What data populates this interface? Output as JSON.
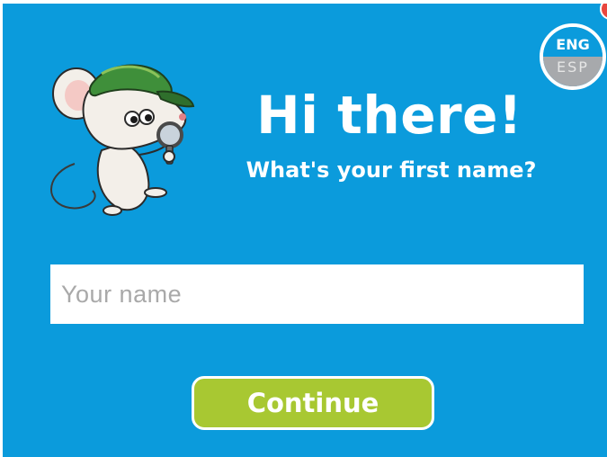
{
  "greeting": {
    "title": "Hi there!",
    "subtitle": "What's your first name?"
  },
  "name_input": {
    "value": "",
    "placeholder": "Your name"
  },
  "continue_button": {
    "label": "Continue"
  },
  "language_toggle": {
    "active": "ENG",
    "inactive": "ESP"
  },
  "mascot": {
    "icon": "detective-mouse-icon"
  },
  "colors": {
    "background": "#0b9bdc",
    "button": "#a8c832",
    "toggle_inactive": "#a7a9ac"
  }
}
